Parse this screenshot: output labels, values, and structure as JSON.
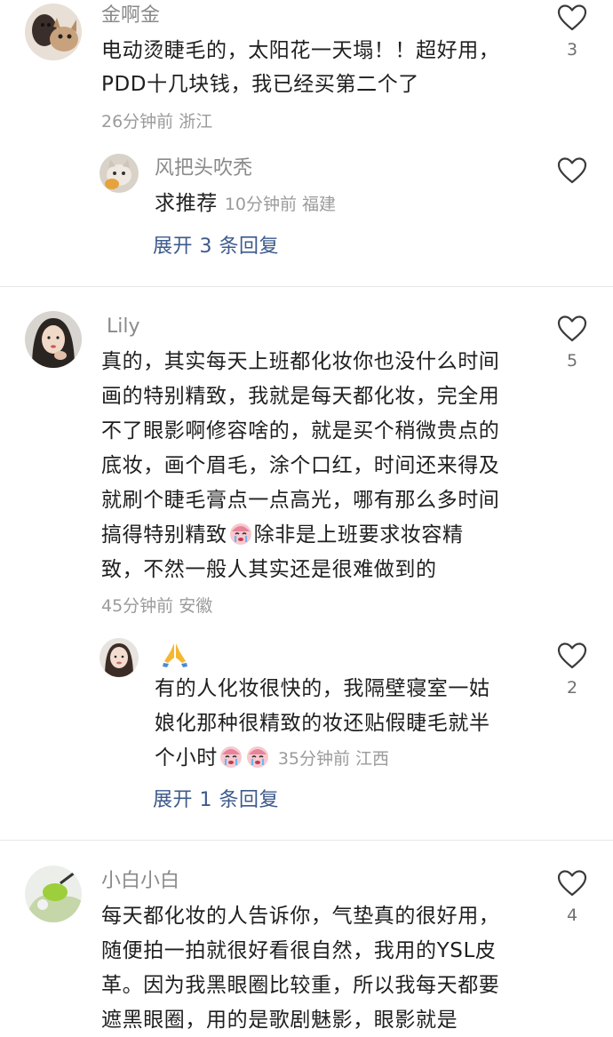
{
  "comments": [
    {
      "username": "金啊金",
      "lines": [
        "电动烫睫毛的，太阳花一天塌！！超好用，",
        "PDD十几块钱，我已经买第二个了"
      ],
      "meta": "26分钟前 浙江",
      "likes": "3",
      "avatar_icon": "cat-avatar-icon",
      "reply": {
        "username": "风把头吹秃",
        "text": "求推荐",
        "meta": "10分钟前 福建",
        "likes": "",
        "avatar_icon": "cat-avatar-icon"
      },
      "expand": "展开 3 条回复"
    },
    {
      "username": "Lily",
      "lines": [
        "真的，其实每天上班都化妆你也没什么时间",
        "画的特别精致，我就是每天都化妆，完全用",
        "不了眼影啊修容啥的，就是买个稍微贵点的",
        "底妆，画个眉毛，涂个口红，时间还来得及",
        "就刷个睫毛膏点一点高光，哪有那么多时间",
        "搞得特别精致",
        "除非是上班要求妆容精",
        "致，不然一般人其实还是很难做到的"
      ],
      "meta": "45分钟前 安徽",
      "likes": "5",
      "avatar_icon": "girl-avatar-icon",
      "reply": {
        "username": "",
        "lines": [
          "有的人化妆很快的，我隔壁寝室一姑",
          "娘化那种很精致的妆还贴假睫毛就半",
          "个小时"
        ],
        "meta": "35分钟前 江西",
        "likes": "2",
        "avatar_icon": "face-avatar-icon",
        "name_icon": "pray-hands-icon"
      },
      "expand": "展开 1 条回复"
    },
    {
      "username": "小白小白",
      "lines": [
        "每天都化妆的人告诉你，气垫真的很好用，",
        "随便拍一拍就很好看很自然，我用的YSL皮",
        "革。因为我黑眼圈比较重，所以我每天都要",
        "遮黑眼圈，用的是歌剧魅影，眼影就是"
      ],
      "likes": "4",
      "avatar_icon": "green-avatar-icon"
    }
  ],
  "colors": {
    "text": "#1f1f1f",
    "meta": "#9b9b9b",
    "link": "#3d5a8c",
    "divider": "#e6e6e6"
  },
  "icons": [
    "heart-outline-icon",
    "crying-face-emoji-icon",
    "pray-hands-icon"
  ]
}
